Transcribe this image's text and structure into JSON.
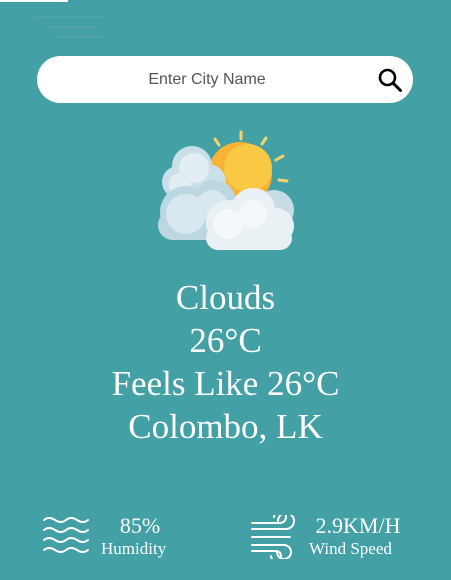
{
  "search": {
    "placeholder": "Enter City Name",
    "icon": "search-icon"
  },
  "weather": {
    "icon": "sun-behind-clouds-icon",
    "condition": "Clouds",
    "temperature": "26°C",
    "feels_like": "Feels Like 26°C",
    "location": "Colombo, LK"
  },
  "humidity": {
    "icon": "humidity-waves-icon",
    "value": "85%",
    "label": "Humidity"
  },
  "wind": {
    "icon": "wind-icon",
    "value": "2.9KM/H",
    "label": "Wind Speed"
  },
  "colors": {
    "background": "#43a1a5",
    "search_bar": "#ffffff",
    "text": "#ffffff",
    "sun": "#f9b233",
    "cloud": "#e8f0f4"
  }
}
